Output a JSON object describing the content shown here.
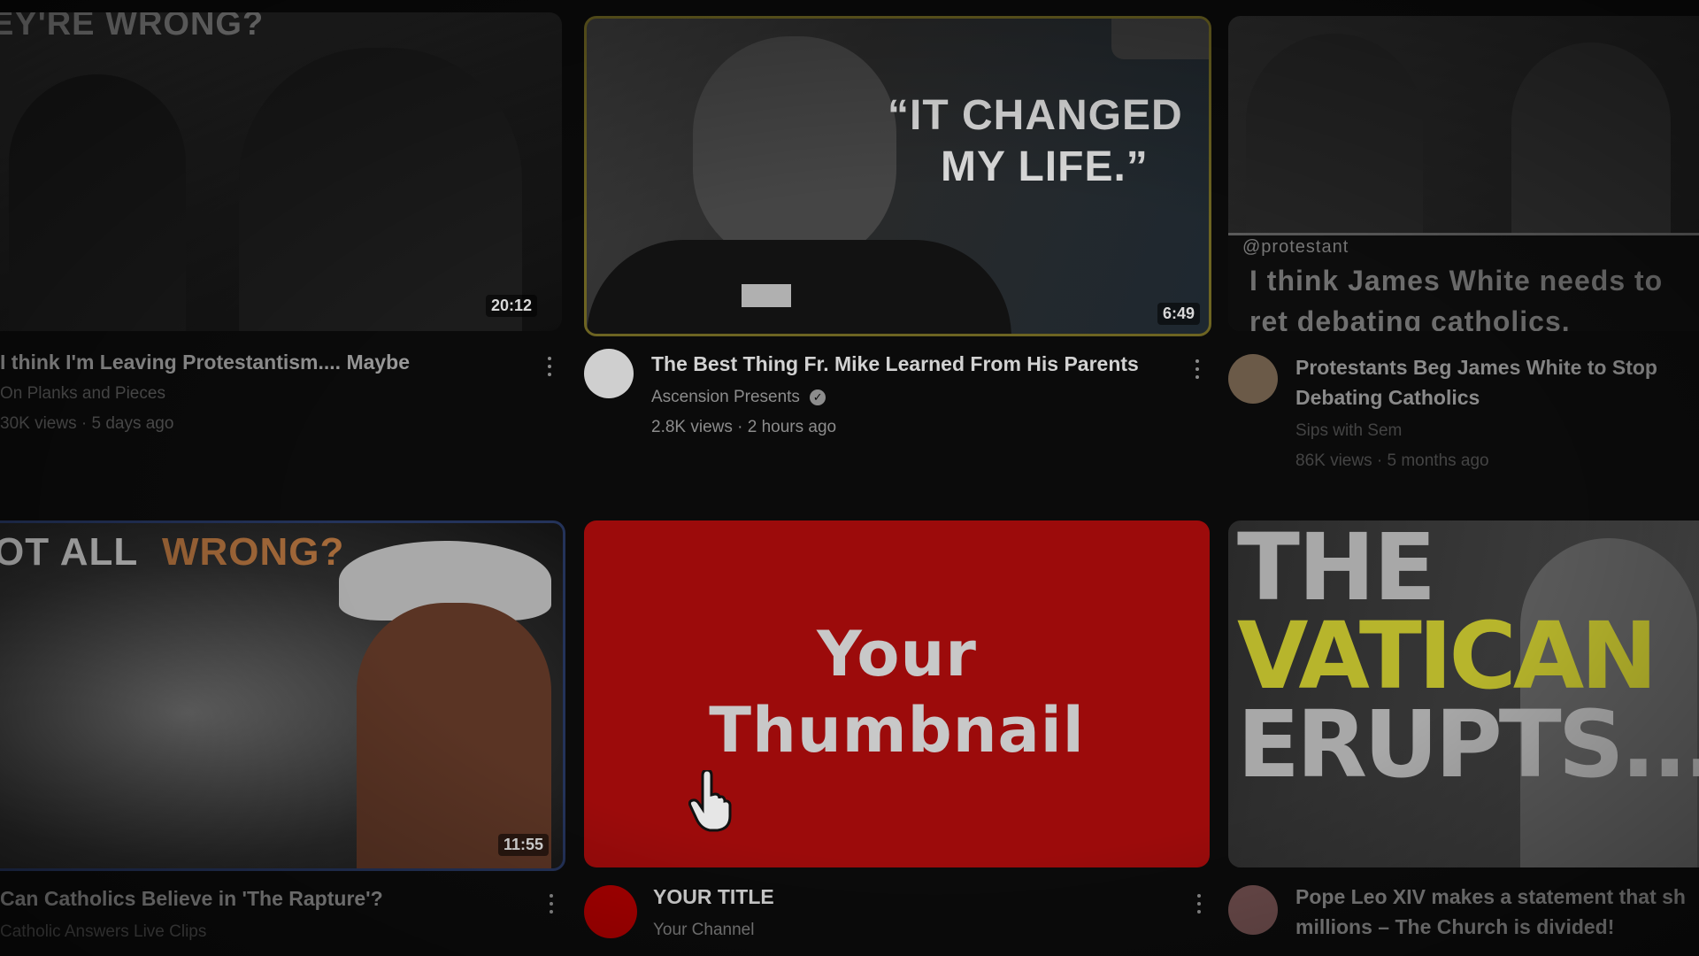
{
  "videos": [
    {
      "thumb_text": "EY'RE WRONG?",
      "duration": "20:12",
      "title": "I think I'm Leaving Protestantism.... Maybe",
      "channel": "On Planks and Pieces",
      "stats": "30K views · 5 days ago"
    },
    {
      "thumb_text_1": "“IT CHANGED",
      "thumb_text_2": "MY LIFE.”",
      "duration": "6:49",
      "title": "The Best Thing Fr. Mike Learned From His Parents",
      "channel": "Ascension Presents",
      "stats": "2.8K views · 2 hours ago"
    },
    {
      "caption_handle": "@protestant",
      "caption_text": "I think James White needs to ret debating catholics.",
      "title": "Protestants Beg James White to Stop Debating Catholics",
      "channel": "Sips with Sem",
      "stats": "86K views · 5 months ago"
    },
    {
      "thumb_text_1": "OT ALL",
      "thumb_text_2": "WRONG?",
      "duration": "11:55",
      "title": "Can Catholics Believe in 'The Rapture'?",
      "channel": "Catholic Answers Live Clips"
    },
    {
      "thumb_text_1": "Your",
      "thumb_text_2": "Thumbnail",
      "title": "YOUR TITLE",
      "channel": "Your Channel"
    },
    {
      "thumb_text_1": "THE",
      "thumb_text_2": "VATICAN",
      "thumb_text_3": "ERUPTS...",
      "title": "Pope Leo XIV makes a statement that sh millions – The Church is divided!"
    }
  ],
  "colors": {
    "your_thumbnail_red": "#a30a0a",
    "avatar_red": "#b30000",
    "vatican_yellow": "#b7b52c",
    "changed_accent": "#e0e0e0"
  },
  "icons": {
    "verified": "check-circle",
    "cursor": "hand-pointer",
    "menu": "more-vertical"
  }
}
